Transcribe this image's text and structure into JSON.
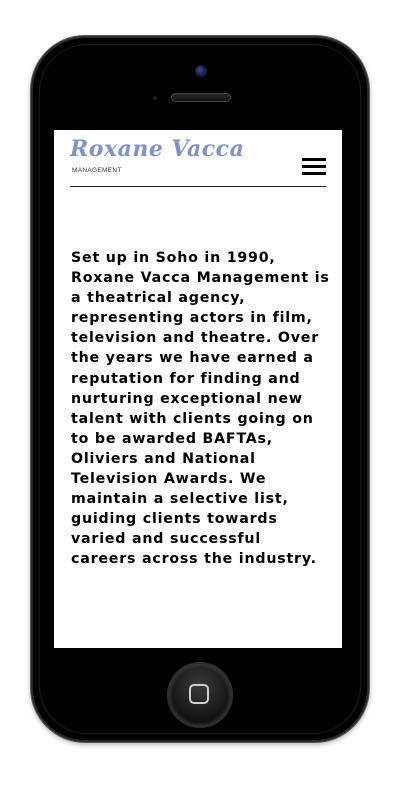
{
  "site": {
    "logo_name": "Roxane Vacca",
    "logo_sub": "MANAGEMENT"
  },
  "icons": {
    "menu": "hamburger-menu-icon",
    "home_button": "home-square-icon"
  },
  "colors": {
    "logo": "#7f93c9",
    "phone_body": "#000000",
    "screen": "#ffffff",
    "text": "#000000"
  },
  "content": {
    "intro": "Set up in Soho in 1990, Roxane Vacca Management is a theatrical agency, representing actors in film, television and theatre. Over the years we have earned a reputation for finding and nurturing exceptional new talent with clients going on to be awarded BAFTAs, Oliviers and National Television Awards. We maintain a selective list, guiding clients towards varied and successful careers across the industry."
  }
}
